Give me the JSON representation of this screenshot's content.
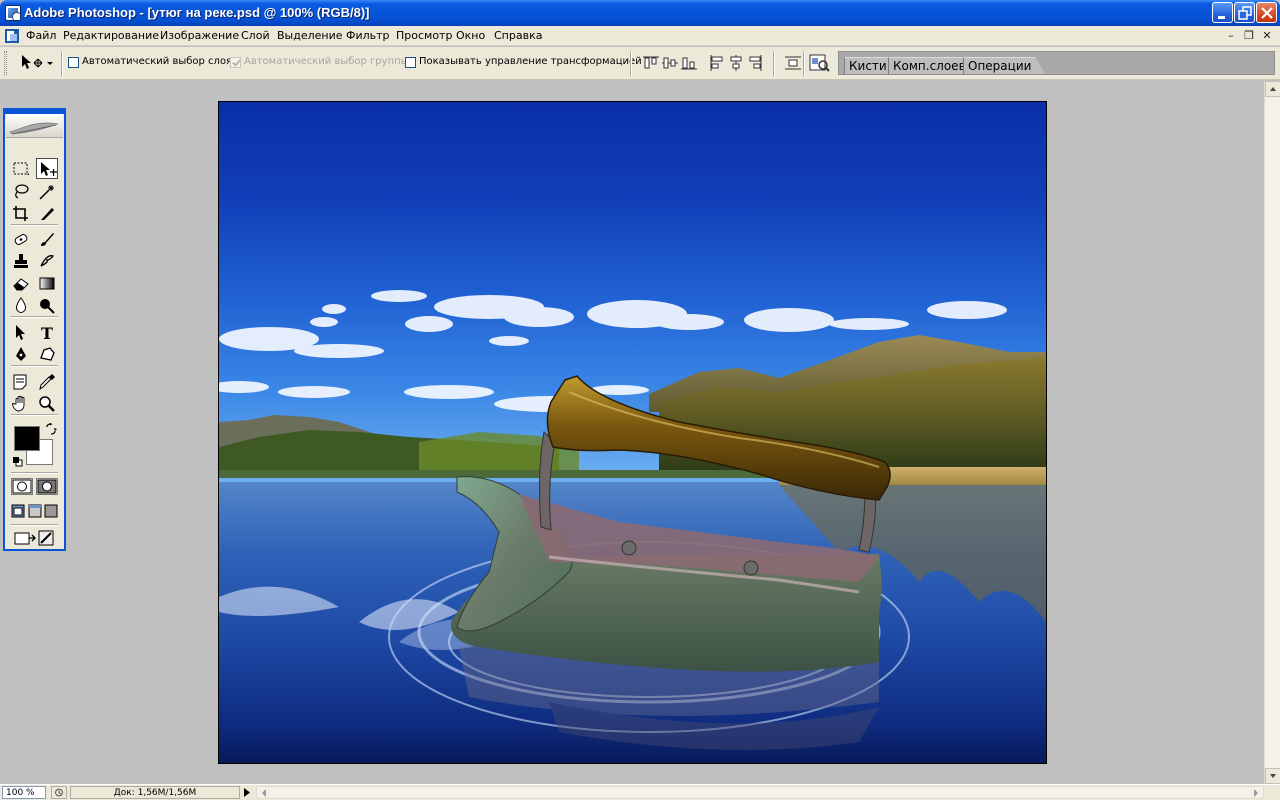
{
  "window": {
    "title": "Adobe Photoshop - [утюг на реке.psd @ 100% (RGB/8)]",
    "buttons": [
      "minimize",
      "restore",
      "close"
    ]
  },
  "menu": {
    "items": [
      "Файл",
      "Редактирование",
      "Изображение",
      "Слой",
      "Выделение",
      "Фильтр",
      "Просмотр",
      "Окно",
      "Справка"
    ]
  },
  "options": {
    "auto_select_layer": {
      "label": "Автоматический выбор слоя",
      "checked": false,
      "enabled": true
    },
    "auto_select_group": {
      "label": "Автоматический выбор группы",
      "checked": true,
      "enabled": false
    },
    "show_transform": {
      "label": "Показывать управление трансформацией",
      "checked": false,
      "enabled": true
    }
  },
  "palette_well": {
    "tabs": [
      "Кисти",
      "Комп.слоев",
      "Операции"
    ]
  },
  "toolbox": {
    "active_tool": "move",
    "foreground_color": "#000000",
    "background_color": "#ffffff"
  },
  "document": {
    "filename": "утюг на реке.psd",
    "zoom": "100 %",
    "doc_info": "Док: 1,56M/1,56M"
  },
  "colors": {
    "title_bar": "#0a5ce4",
    "chrome": "#ece9d8",
    "workspace": "#c0c0c0",
    "toolbox_frame": "#0a55d5"
  }
}
